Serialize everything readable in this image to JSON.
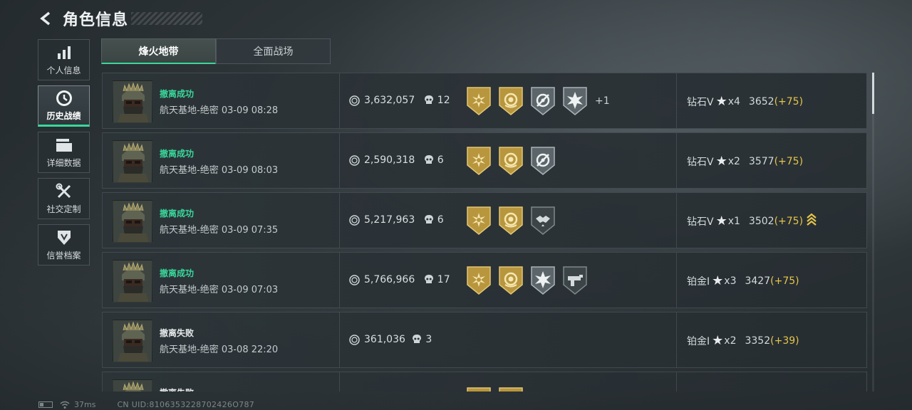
{
  "header": {
    "title": "角色信息"
  },
  "sidebar": {
    "items": [
      {
        "label": "个人信息",
        "icon": "bar-chart-icon",
        "active": false
      },
      {
        "label": "历史战绩",
        "icon": "clock-icon",
        "active": true
      },
      {
        "label": "详细数据",
        "icon": "cards-icon",
        "active": false
      },
      {
        "label": "社交定制",
        "icon": "tools-icon",
        "active": false
      },
      {
        "label": "信誉档案",
        "icon": "shield-icon",
        "active": false
      }
    ]
  },
  "tabs": [
    {
      "label": "烽火地带",
      "active": true
    },
    {
      "label": "全面战场",
      "active": false
    }
  ],
  "records": [
    {
      "status": "撤离成功",
      "result": "success",
      "map": "航天基地-绝密 03-09 08:28",
      "value": "3,632,057",
      "kills": "12",
      "badges": [
        "gold-sun-badge-icon",
        "gold-wreath-badge-icon",
        "silver-target-badge-icon",
        "silver-burst-badge-icon"
      ],
      "more": "+1",
      "rank": "钻石V",
      "stars": "x4",
      "score": "3652",
      "delta": "(+75)"
    },
    {
      "status": "撤离成功",
      "result": "success",
      "map": "航天基地-绝密 03-09 08:03",
      "value": "2,590,318",
      "kills": "6",
      "badges": [
        "gold-sun-badge-icon",
        "gold-wreath-badge-icon",
        "silver-target-badge-icon"
      ],
      "more": "",
      "rank": "钻石V",
      "stars": "x2",
      "score": "3577",
      "delta": "(+75)"
    },
    {
      "status": "撤离成功",
      "result": "success",
      "map": "航天基地-绝密 03-09 07:35",
      "value": "5,217,963",
      "kills": "6",
      "badges": [
        "gold-sun-badge-icon",
        "gold-wreath-badge-icon",
        "dark-handshake-badge-icon"
      ],
      "more": "",
      "rank": "钻石V",
      "stars": "x1",
      "score": "3502",
      "delta": "(+75)",
      "promoted": true
    },
    {
      "status": "撤离成功",
      "result": "success",
      "map": "航天基地-绝密 03-09 07:03",
      "value": "5,766,966",
      "kills": "17",
      "badges": [
        "gold-sun-badge-icon",
        "gold-wreath-badge-icon",
        "silver-burst-badge-icon",
        "dark-gun-badge-icon"
      ],
      "more": "",
      "rank": "铂金I",
      "stars": "x3",
      "score": "3427",
      "delta": "(+75)"
    },
    {
      "status": "撤离失败",
      "result": "fail",
      "map": "航天基地-绝密 03-08 22:20",
      "value": "361,036",
      "kills": "3",
      "badges": [],
      "more": "",
      "rank": "铂金I",
      "stars": "x2",
      "score": "3352",
      "delta": "(+39)"
    },
    {
      "status": "撤离失败",
      "result": "fail",
      "map": "",
      "value": "",
      "kills": "",
      "badges": [
        "gold-sun-badge-icon",
        "gold-wreath-badge-icon"
      ],
      "more": "",
      "rank": "",
      "stars": "",
      "score": "",
      "delta": ""
    }
  ],
  "statusbar": {
    "ping": "37ms",
    "uid": "CN UID:8106353228702426O787"
  },
  "colors": {
    "accent_green": "#39d79a",
    "delta_gold": "#e5c54a",
    "badge_gold": "#c9a84a"
  }
}
